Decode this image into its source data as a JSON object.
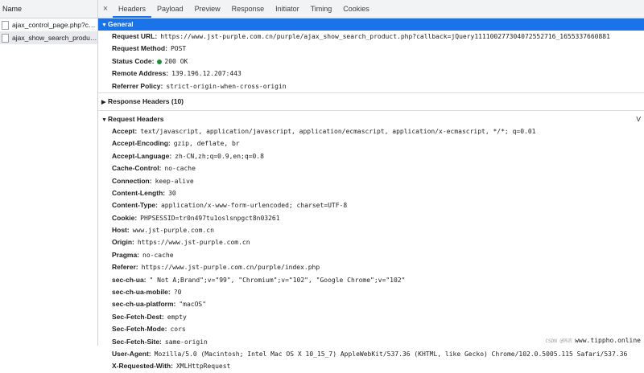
{
  "left": {
    "column_header": "Name",
    "requests": [
      {
        "name": "ajax_control_page.php?call…"
      },
      {
        "name": "ajax_show_search_product…"
      }
    ]
  },
  "tabs": {
    "close": "×",
    "items": [
      "Headers",
      "Payload",
      "Preview",
      "Response",
      "Initiator",
      "Timing",
      "Cookies"
    ]
  },
  "general": {
    "title": "General",
    "rows": [
      {
        "k": "Request URL:",
        "v": "https://www.jst-purple.com.cn/purple/ajax_show_search_product.php?callback=jQuery111100277304072552716_1655337660881"
      },
      {
        "k": "Request Method:",
        "v": "POST"
      },
      {
        "k": "Status Code:",
        "v": "200 OK"
      },
      {
        "k": "Remote Address:",
        "v": "139.196.12.207:443"
      },
      {
        "k": "Referrer Policy:",
        "v": "strict-origin-when-cross-origin"
      }
    ]
  },
  "response_headers": {
    "title": "Response Headers (10)"
  },
  "request_headers": {
    "title": "Request Headers",
    "view_source": "V",
    "rows": [
      {
        "k": "Accept:",
        "v": "text/javascript, application/javascript, application/ecmascript, application/x-ecmascript, */*; q=0.01"
      },
      {
        "k": "Accept-Encoding:",
        "v": "gzip, deflate, br"
      },
      {
        "k": "Accept-Language:",
        "v": "zh-CN,zh;q=0.9,en;q=0.8"
      },
      {
        "k": "Cache-Control:",
        "v": "no-cache"
      },
      {
        "k": "Connection:",
        "v": "keep-alive"
      },
      {
        "k": "Content-Length:",
        "v": "30"
      },
      {
        "k": "Content-Type:",
        "v": "application/x-www-form-urlencoded; charset=UTF-8"
      },
      {
        "k": "Cookie:",
        "v": "PHPSESSID=tr0n497tu1oslsnpgct8n03261"
      },
      {
        "k": "Host:",
        "v": "www.jst-purple.com.cn"
      },
      {
        "k": "Origin:",
        "v": "https://www.jst-purple.com.cn"
      },
      {
        "k": "Pragma:",
        "v": "no-cache"
      },
      {
        "k": "Referer:",
        "v": "https://www.jst-purple.com.cn/purple/index.php"
      },
      {
        "k": "sec-ch-ua:",
        "v": "\" Not A;Brand\";v=\"99\", \"Chromium\";v=\"102\", \"Google Chrome\";v=\"102\""
      },
      {
        "k": "sec-ch-ua-mobile:",
        "v": "?0"
      },
      {
        "k": "sec-ch-ua-platform:",
        "v": "\"macOS\""
      },
      {
        "k": "Sec-Fetch-Dest:",
        "v": "empty"
      },
      {
        "k": "Sec-Fetch-Mode:",
        "v": "cors"
      },
      {
        "k": "Sec-Fetch-Site:",
        "v": "same-origin"
      },
      {
        "k": "User-Agent:",
        "v": "Mozilla/5.0 (Macintosh; Intel Mac OS X 10_15_7) AppleWebKit/537.36 (KHTML, like Gecko) Chrome/102.0.5005.115 Safari/537.36"
      },
      {
        "k": "X-Requested-With:",
        "v": "XMLHttpRequest"
      }
    ]
  },
  "watermark": {
    "small": "CSDN @码农",
    "text": "www.tippho.online"
  },
  "colors": {
    "accent": "#1a73e8",
    "status_ok": "#1e8e3e"
  }
}
